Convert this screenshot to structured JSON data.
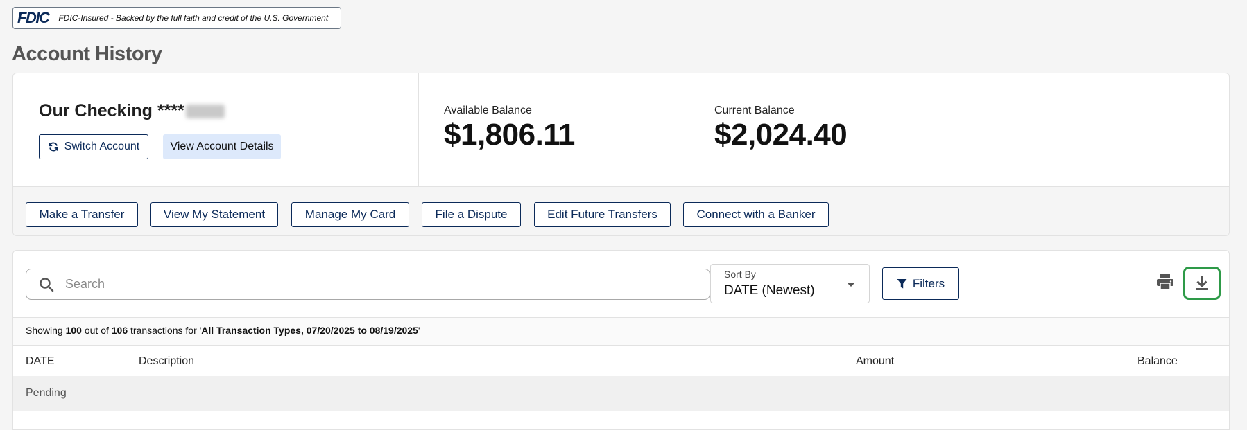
{
  "fdic": {
    "logo": "FDIC",
    "text": "FDIC-Insured - Backed by the full faith and credit of the U.S. Government"
  },
  "page": {
    "title": "Account History"
  },
  "account": {
    "name": "Our Checking ****",
    "switch_label": "Switch Account",
    "details_label": "View Account Details",
    "available_label": "Available Balance",
    "available_value": "$1,806.11",
    "current_label": "Current Balance",
    "current_value": "$2,024.40"
  },
  "actions": [
    {
      "label": "Make a Transfer"
    },
    {
      "label": "View My Statement"
    },
    {
      "label": "Manage My Card"
    },
    {
      "label": "File a Dispute"
    },
    {
      "label": "Edit Future Transfers"
    },
    {
      "label": "Connect with a Banker"
    }
  ],
  "toolbar": {
    "search_placeholder": "Search",
    "sort_label": "Sort By",
    "sort_value": "DATE (Newest)",
    "filters_label": "Filters"
  },
  "summary": {
    "prefix": "Showing ",
    "shown": "100",
    "mid1": " out of ",
    "total": "106",
    "mid2": " transactions for '",
    "criteria": "All Transaction Types, 07/20/2025 to 08/19/2025",
    "suffix": "'"
  },
  "table": {
    "columns": [
      "DATE",
      "Description",
      "Amount",
      "Balance"
    ],
    "group_label": "Pending"
  },
  "colors": {
    "brand_navy": "#0b2a59",
    "highlight_green": "#2e9a48",
    "details_button_bg": "#dde9fb"
  }
}
